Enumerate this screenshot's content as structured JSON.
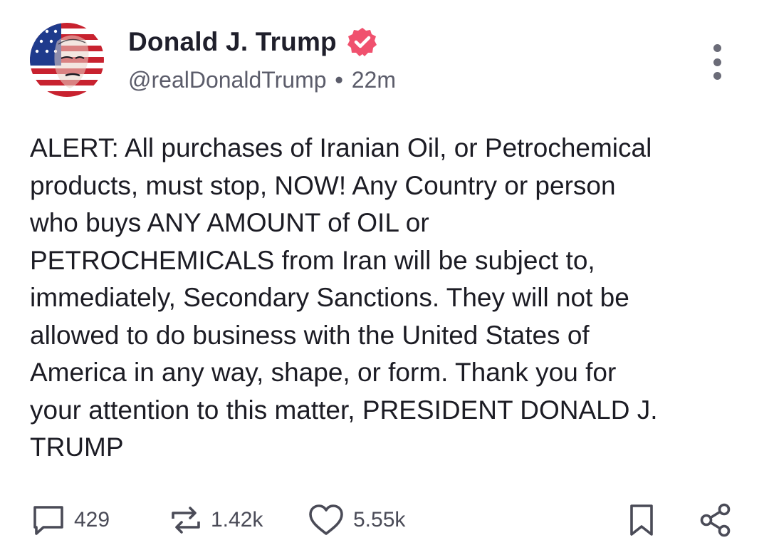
{
  "post": {
    "author": {
      "display_name": "Donald J. Trump",
      "handle": "@realDonaldTrump",
      "verified": true,
      "avatar": "avatar-flag-portrait"
    },
    "separator": "•",
    "time_ago": "22m",
    "text": "ALERT: All purchases of Iranian Oil, or Petrochemical\nproducts, must stop, NOW! Any Country or person\nwho buys ANY AMOUNT of OIL or\nPETROCHEMICALS from Iran will be subject to,\nimmediately, Secondary Sanctions. They will not be\nallowed to do business with the United States of\nAmerica in any way, shape, or form. Thank you for\nyour attention to this matter, PRESIDENT DONALD J.\nTRUMP",
    "actions": {
      "replies": "429",
      "retruths": "1.42k",
      "likes": "5.55k"
    },
    "icons": {
      "verified": "verified-badge-icon",
      "more": "more-vertical-icon",
      "reply": "reply-icon",
      "retruth": "retruth-icon",
      "like": "heart-icon",
      "bookmark": "bookmark-icon",
      "share": "share-icon"
    },
    "colors": {
      "verified_badge": "#f0516e",
      "text": "#1c1c24",
      "meta": "#5b5c6a",
      "icon": "#4a4b57"
    }
  }
}
